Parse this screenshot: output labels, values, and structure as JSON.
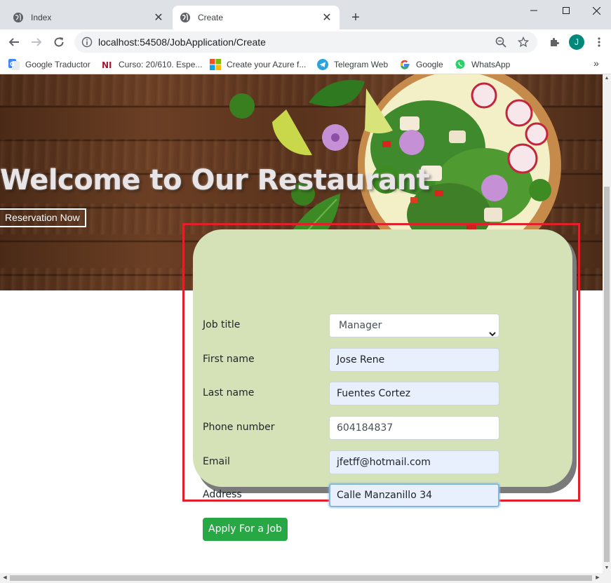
{
  "browser": {
    "tabs": [
      {
        "label": "Index",
        "active": false
      },
      {
        "label": "Create",
        "active": true
      }
    ],
    "new_tab": "+",
    "address": "localhost:54508/JobApplication/Create",
    "profile_initial": "J",
    "bookmarks": [
      {
        "label": "Google Traductor",
        "icon": "google-translate-icon"
      },
      {
        "label": "Curso: 20/610. Espe...",
        "icon": "ni-icon"
      },
      {
        "label": "Create your Azure f...",
        "icon": "microsoft-icon"
      },
      {
        "label": "Telegram Web",
        "icon": "telegram-icon"
      },
      {
        "label": "Google",
        "icon": "google-icon"
      },
      {
        "label": "WhatsApp",
        "icon": "whatsapp-icon"
      }
    ],
    "bookmarks_more": "»"
  },
  "hero": {
    "title": "Welcome to Our Restaurant",
    "button": "Reservation Now"
  },
  "form": {
    "fields": [
      {
        "label": "Job title",
        "value": "Manager",
        "type": "select"
      },
      {
        "label": "First name",
        "value": "Jose Rene",
        "type": "text"
      },
      {
        "label": "Last name",
        "value": "Fuentes Cortez",
        "type": "text"
      },
      {
        "label": "Phone number",
        "value": "604184837",
        "type": "text"
      },
      {
        "label": "Email",
        "value": "jfetff@hotmail.com",
        "type": "text"
      },
      {
        "label": "Address",
        "value": "Calle Manzanillo 34",
        "type": "text",
        "focused": true
      }
    ],
    "submit": "Apply For a Job"
  },
  "colors": {
    "form_background": "#d5e2b8",
    "highlight_border": "#e0202a",
    "submit_button": "#28a745",
    "autofill_background": "#e8f0fe"
  }
}
